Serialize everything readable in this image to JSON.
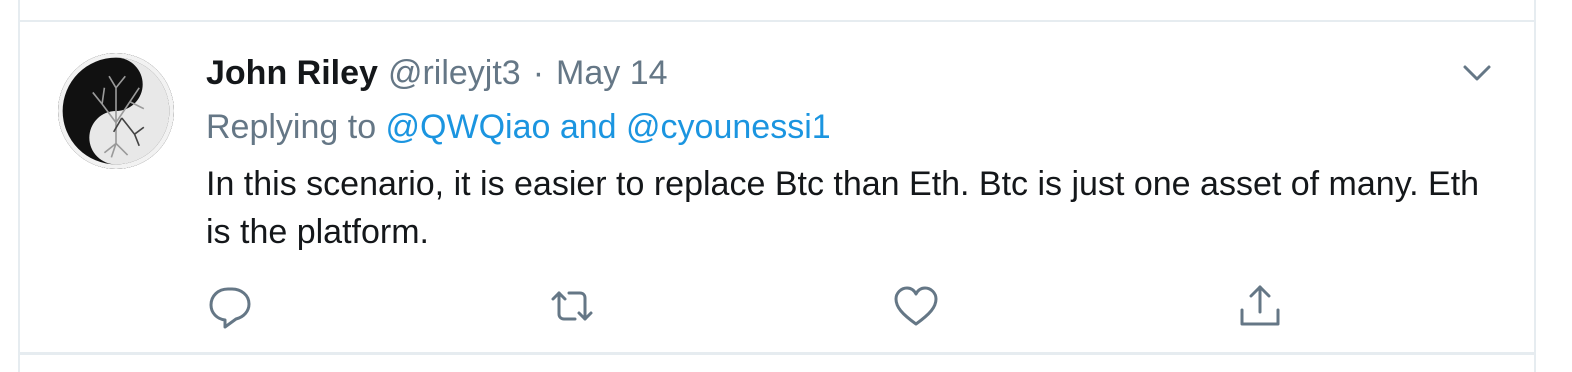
{
  "tweet": {
    "author_name": "John Riley",
    "author_handle": "@rileyjt3",
    "separator": "·",
    "date": "May 14",
    "replying_prefix": "Replying to ",
    "mention_1": "@QWQiao",
    "mention_joiner": " and ",
    "mention_2": "@cyounessi1",
    "text": "In this scenario, it is easier to replace Btc than Eth. Btc is just one asset of many. Eth is the platform."
  },
  "icons": {
    "avatar": "yin-yang-tree-avatar",
    "more": "chevron-down-icon",
    "reply": "reply-icon",
    "retweet": "retweet-icon",
    "like": "heart-icon",
    "share": "share-icon"
  },
  "colors": {
    "text_primary": "#14171a",
    "text_secondary": "#657786",
    "link": "#1b95e0",
    "border": "#e6ecf0"
  }
}
